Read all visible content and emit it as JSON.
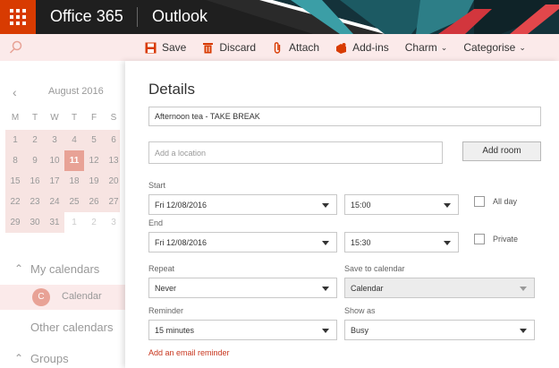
{
  "header": {
    "brand": "Office 365",
    "app": "Outlook"
  },
  "toolbar": {
    "save": "Save",
    "discard": "Discard",
    "attach": "Attach",
    "addins": "Add-ins",
    "charm": "Charm",
    "categorise": "Categorise"
  },
  "sidebar": {
    "month": "August 2016",
    "weekdays": [
      "M",
      "T",
      "W",
      "T",
      "F",
      "S"
    ],
    "weeks": [
      [
        "1",
        "2",
        "3",
        "4",
        "5",
        "6"
      ],
      [
        "8",
        "9",
        "10",
        "11",
        "12",
        "13"
      ],
      [
        "15",
        "16",
        "17",
        "18",
        "19",
        "20"
      ],
      [
        "22",
        "23",
        "24",
        "25",
        "26",
        "27"
      ],
      [
        "29",
        "30",
        "31",
        "1",
        "2",
        "3"
      ]
    ],
    "selected_day": "11",
    "my_calendars": "My calendars",
    "calendar_item": "Calendar",
    "calendar_avatar": "C",
    "other_calendars": "Other calendars",
    "groups": "Groups"
  },
  "details": {
    "title": "Details",
    "event_title": "Afternoon tea - TAKE BREAK",
    "location_placeholder": "Add a location",
    "add_room": "Add room",
    "start_label": "Start",
    "start_date": "Fri 12/08/2016",
    "start_time": "15:00",
    "all_day": "All day",
    "end_label": "End",
    "end_date": "Fri 12/08/2016",
    "end_time": "15:30",
    "private": "Private",
    "repeat_label": "Repeat",
    "repeat_value": "Never",
    "save_to_label": "Save to calendar",
    "save_to_value": "Calendar",
    "reminder_label": "Reminder",
    "reminder_value": "15 minutes",
    "show_as_label": "Show as",
    "show_as_value": "Busy",
    "email_reminder_link": "Add an email reminder"
  },
  "colors": {
    "accent": "#d83b01",
    "tint": "#fbeaea",
    "selected_day": "#e8a296",
    "link": "#c8361e"
  },
  "icons": [
    "app-launcher-icon",
    "search-icon",
    "save-icon",
    "discard-icon",
    "attach-icon",
    "addins-icon",
    "chevron-down-icon",
    "chevron-left-icon",
    "chevron-up-icon"
  ]
}
